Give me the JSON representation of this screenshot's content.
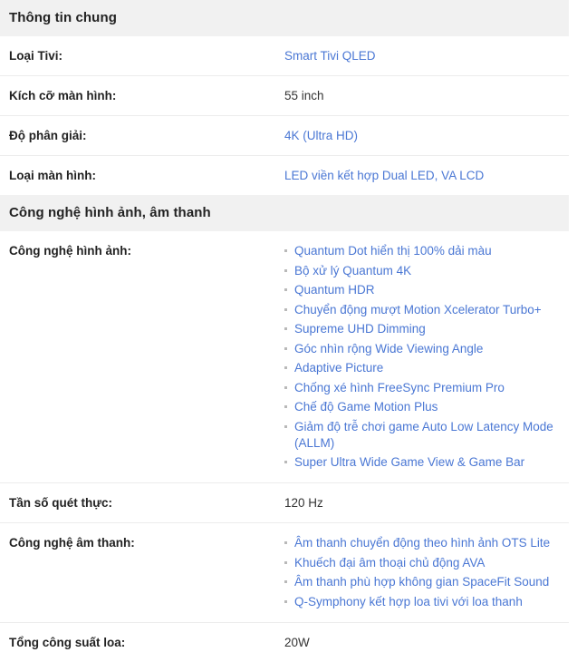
{
  "page": {
    "title": "Thông tin chung"
  },
  "sections": [
    {
      "header": "Thông tin chung",
      "rows": [
        {
          "label": "Loại Tivi:",
          "value": "Smart Tivi QLED",
          "style": "link"
        },
        {
          "label": "Kích cỡ màn hình:",
          "value": "55 inch",
          "style": "plain"
        },
        {
          "label": "Độ phân giải:",
          "value": "4K (Ultra HD)",
          "style": "link"
        },
        {
          "label": "Loại màn hình:",
          "value": "LED viền kết hợp Dual LED, VA LCD",
          "style": "link"
        }
      ]
    },
    {
      "header": "Công nghệ hình ảnh, âm thanh",
      "rows": [
        {
          "label": "Công nghệ hình ảnh:",
          "style": "list",
          "items": [
            "Quantum Dot hiển thị 100% dải màu",
            "Bộ xử lý Quantum 4K",
            "Quantum HDR",
            "Chuyển động mượt Motion Xcelerator Turbo+",
            "Supreme UHD Dimming",
            "Góc nhìn rộng Wide Viewing Angle",
            "Adaptive Picture",
            "Chống xé hình FreeSync Premium Pro",
            "Chế độ Game Motion Plus",
            "Giảm độ trễ chơi game Auto Low Latency Mode (ALLM)",
            "Super Ultra Wide Game View & Game Bar"
          ]
        },
        {
          "label": "Tần số quét thực:",
          "value": "120 Hz",
          "style": "plain"
        },
        {
          "label": "Công nghệ âm thanh:",
          "style": "list",
          "items": [
            "Âm thanh chuyển động theo hình ảnh OTS Lite",
            "Khuếch đại âm thoại chủ động AVA",
            "Âm thanh phù hợp không gian SpaceFit Sound",
            "Q-Symphony kết hợp loa tivi với loa thanh"
          ]
        },
        {
          "label": "Tổng công suất loa:",
          "value": "20W",
          "style": "plain"
        }
      ]
    }
  ],
  "colors": {
    "link": "#4a77d4",
    "header_background": "#f1f1f1",
    "text": "#333333",
    "label": "#222222",
    "divider": "#ececec",
    "bullet": "#b9b9b9"
  }
}
